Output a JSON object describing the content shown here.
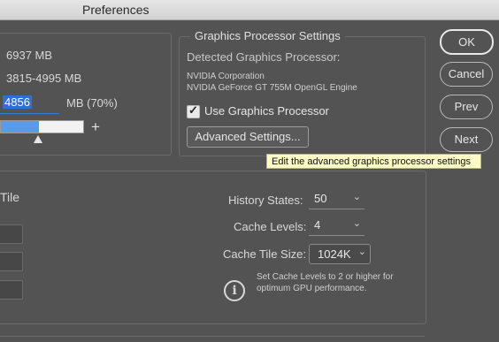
{
  "window": {
    "title": "Preferences"
  },
  "memory": {
    "available": "6937 MB",
    "ideal_range": "3815-4995 MB",
    "let_photoshop_use_value": "4856",
    "let_photoshop_use_suffix": "MB (70%)",
    "slider_plus": "+",
    "slider_fraction": 0.7
  },
  "graphics": {
    "legend": "Graphics Processor Settings",
    "detected_label": "Detected Graphics Processor:",
    "gpu_vendor": "NVIDIA Corporation",
    "gpu_name": "NVIDIA GeForce GT 755M OpenGL Engine",
    "use_gpu_label": "Use Graphics Processor",
    "use_gpu_checked": true,
    "checkmark": "✓",
    "advanced_button": "Advanced Settings..."
  },
  "tooltip": {
    "text": "Edit the advanced graphics processor settings"
  },
  "history_cache": {
    "partial_label": "Tile",
    "history_states_label": "History States:",
    "history_states_value": "50",
    "cache_levels_label": "Cache Levels:",
    "cache_levels_value": "4",
    "cache_tile_size_label": "Cache Tile Size:",
    "cache_tile_size_value": "1024K",
    "info_line1": "Set Cache Levels to 2 or higher for",
    "info_line2": "optimum GPU performance.",
    "info_icon_glyph": "i",
    "chevron": "⌄"
  },
  "buttons": {
    "ok": "OK",
    "cancel": "Cancel",
    "prev": "Prev",
    "next": "Next"
  }
}
